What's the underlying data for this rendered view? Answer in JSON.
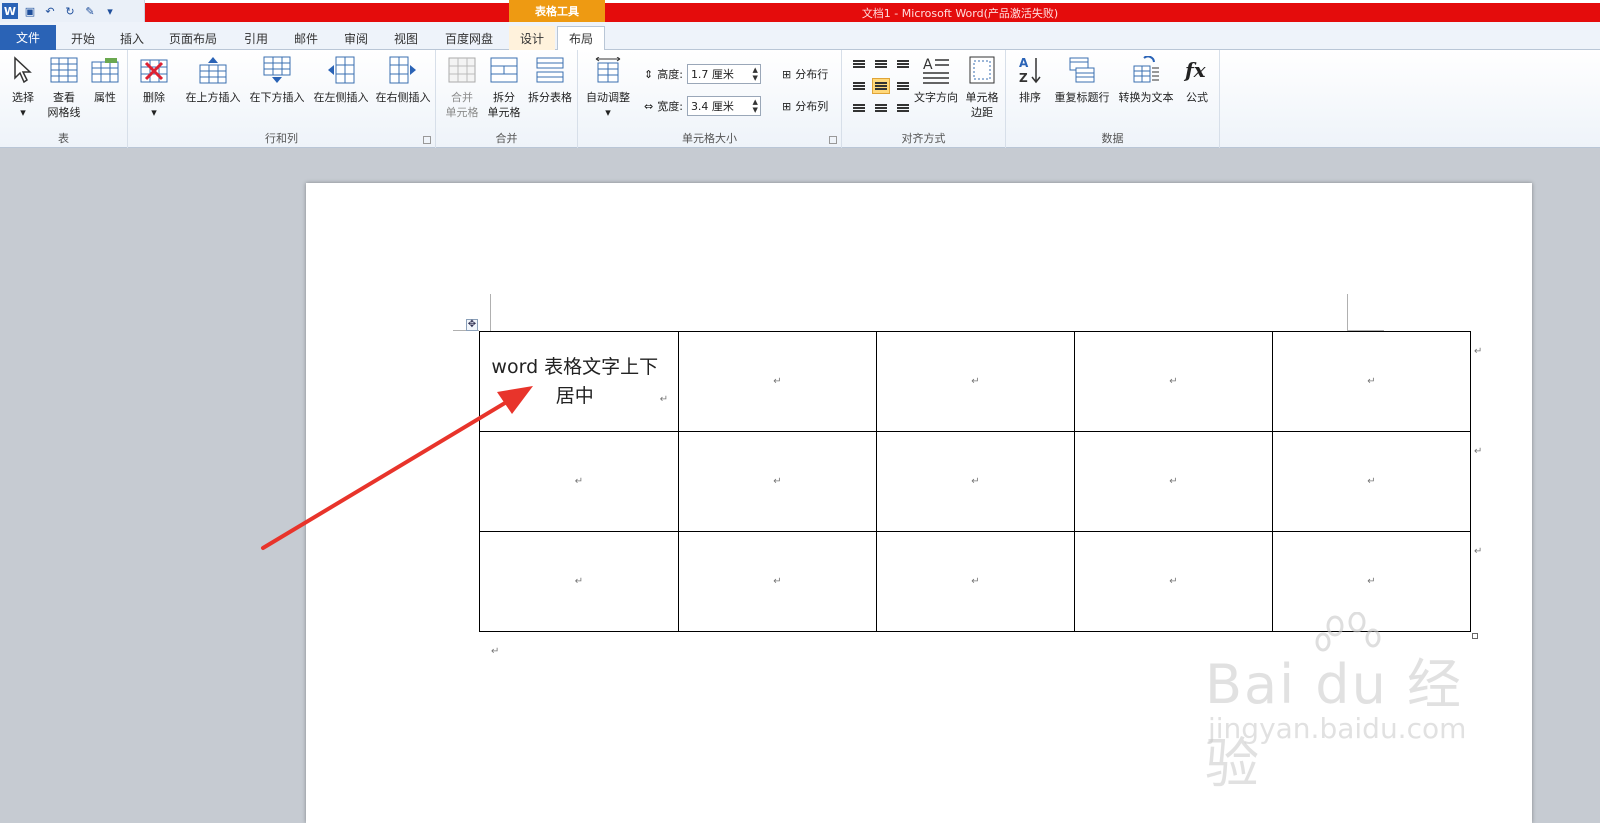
{
  "titlebar": {
    "context_tab": "表格工具",
    "window_title": "文档1 - Microsoft Word(产品激活失败)",
    "qat_icons": [
      "word-icon",
      "save-icon",
      "undo-icon",
      "redo-icon",
      "customize-icon"
    ]
  },
  "tabs": [
    {
      "label": "文件",
      "state": "file"
    },
    {
      "label": "开始"
    },
    {
      "label": "插入"
    },
    {
      "label": "页面布局"
    },
    {
      "label": "引用"
    },
    {
      "label": "邮件"
    },
    {
      "label": "审阅"
    },
    {
      "label": "视图"
    },
    {
      "label": "百度网盘"
    },
    {
      "label": "设计",
      "state": "context"
    },
    {
      "label": "布局",
      "state": "active"
    }
  ],
  "ribbon": {
    "table_group": {
      "label": "表",
      "select": "选择",
      "view_grid_1": "查看",
      "view_grid_2": "网格线",
      "properties": "属性"
    },
    "rows_cols_group": {
      "label": "行和列",
      "delete": "删除",
      "insert_above": "在上方插入",
      "insert_below": "在下方插入",
      "insert_left": "在左侧插入",
      "insert_right": "在右侧插入"
    },
    "merge_group": {
      "label": "合并",
      "merge_cells_1": "合并",
      "merge_cells_2": "单元格",
      "split_cells_1": "拆分",
      "split_cells_2": "单元格",
      "split_table": "拆分表格"
    },
    "cell_size_group": {
      "label": "单元格大小",
      "autofit": "自动调整",
      "height_label": "高度:",
      "height_value": "1.7 厘米",
      "width_label": "宽度:",
      "width_value": "3.4 厘米",
      "distribute_rows": "分布行",
      "distribute_cols": "分布列"
    },
    "alignment_group": {
      "label": "对齐方式",
      "text_direction": "文字方向",
      "cell_margins_1": "单元格",
      "cell_margins_2": "边距"
    },
    "data_group": {
      "label": "数据",
      "sort": "排序",
      "repeat_header": "重复标题行",
      "convert_to_text": "转换为文本",
      "formula": "公式"
    }
  },
  "document": {
    "cell_text": "word 表格文字上下居中",
    "para_mark": "↵"
  },
  "watermark": {
    "brand": "Bai du 经验",
    "url": "jingyan.baidu.com"
  },
  "colors": {
    "title_red": "#e40c0c",
    "context_orange": "#ee9a12",
    "file_tab_blue": "#2a63b6",
    "arrow_red": "#e8342b"
  }
}
